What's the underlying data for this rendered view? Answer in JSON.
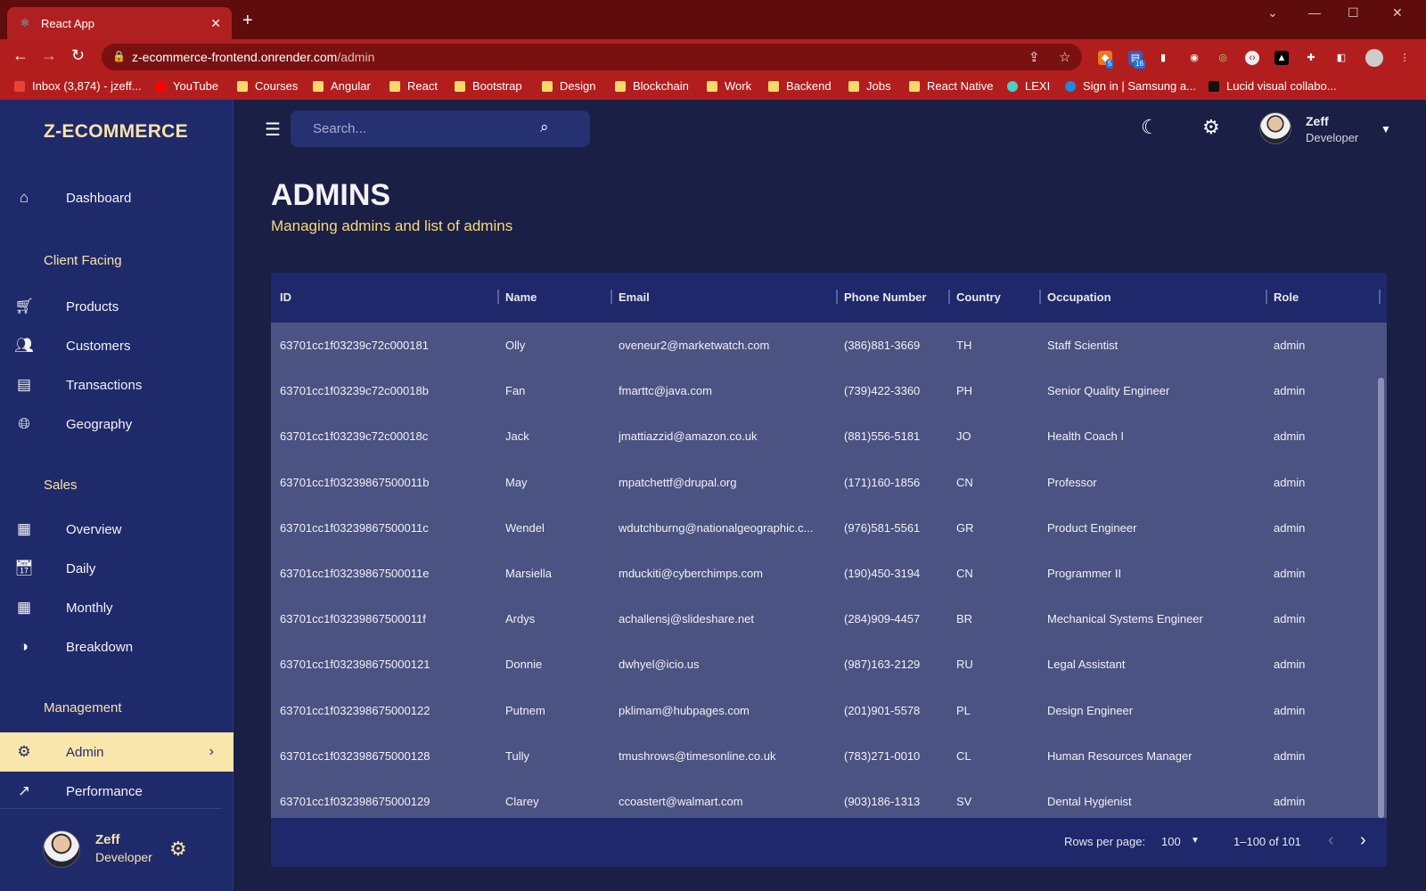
{
  "browser": {
    "tab_title": "React App",
    "tab_close": "✕",
    "new_tab": "+",
    "url_host": "z-ecommerce-frontend.onrender.com",
    "url_path": "/admin",
    "ext_badge_1": "5",
    "ext_badge_2": "16",
    "bookmarks": [
      {
        "label": "Inbox (3,874) - jzeff..."
      },
      {
        "label": "YouTube"
      },
      {
        "label": "Courses"
      },
      {
        "label": "Angular"
      },
      {
        "label": "React"
      },
      {
        "label": "Bootstrap"
      },
      {
        "label": "Design"
      },
      {
        "label": "Blockchain"
      },
      {
        "label": "Work"
      },
      {
        "label": "Backend"
      },
      {
        "label": "Jobs"
      },
      {
        "label": "React Native"
      },
      {
        "label": "LEXI"
      },
      {
        "label": "Sign in | Samsung a..."
      },
      {
        "label": "Lucid visual collabo..."
      }
    ]
  },
  "sidebar": {
    "brand": "Z-ECOMMERCE",
    "items": [
      {
        "label": "Dashboard",
        "icon": "home-icon"
      },
      {
        "label": "Client Facing"
      },
      {
        "label": "Products",
        "icon": "cart-icon"
      },
      {
        "label": "Customers",
        "icon": "people-icon"
      },
      {
        "label": "Transactions",
        "icon": "receipt-icon"
      },
      {
        "label": "Geography",
        "icon": "globe-icon"
      },
      {
        "label": "Sales"
      },
      {
        "label": "Overview",
        "icon": "point-of-sale-icon"
      },
      {
        "label": "Daily",
        "icon": "today-icon"
      },
      {
        "label": "Monthly",
        "icon": "calendar-month-icon"
      },
      {
        "label": "Breakdown",
        "icon": "pie-chart-icon"
      },
      {
        "label": "Management"
      },
      {
        "label": "Admin",
        "icon": "admin-icon",
        "active": true
      },
      {
        "label": "Performance",
        "icon": "trending-up-icon"
      }
    ],
    "user": {
      "name": "Zeff",
      "role": "Developer"
    }
  },
  "topbar": {
    "search_placeholder": "Search...",
    "user": {
      "name": "Zeff",
      "role": "Developer"
    }
  },
  "header": {
    "title": "ADMINS",
    "subtitle": "Managing admins and list of admins"
  },
  "grid": {
    "columns": [
      "ID",
      "Name",
      "Email",
      "Phone Number",
      "Country",
      "Occupation",
      "Role"
    ],
    "rows": [
      [
        "63701cc1f03239c72c000181",
        "Olly",
        "oveneur2@marketwatch.com",
        "(386)881-3669",
        "TH",
        "Staff Scientist",
        "admin"
      ],
      [
        "63701cc1f03239c72c00018b",
        "Fan",
        "fmarttc@java.com",
        "(739)422-3360",
        "PH",
        "Senior Quality Engineer",
        "admin"
      ],
      [
        "63701cc1f03239c72c00018c",
        "Jack",
        "jmattiazzid@amazon.co.uk",
        "(881)556-5181",
        "JO",
        "Health Coach I",
        "admin"
      ],
      [
        "63701cc1f03239867500011b",
        "May",
        "mpatchettf@drupal.org",
        "(171)160-1856",
        "CN",
        "Professor",
        "admin"
      ],
      [
        "63701cc1f03239867500011c",
        "Wendel",
        "wdutchburng@nationalgeographic.c...",
        "(976)581-5561",
        "GR",
        "Product Engineer",
        "admin"
      ],
      [
        "63701cc1f03239867500011e",
        "Marsiella",
        "mduckiti@cyberchimps.com",
        "(190)450-3194",
        "CN",
        "Programmer II",
        "admin"
      ],
      [
        "63701cc1f03239867500011f",
        "Ardys",
        "achallensj@slideshare.net",
        "(284)909-4457",
        "BR",
        "Mechanical Systems Engineer",
        "admin"
      ],
      [
        "63701cc1f032398675000121",
        "Donnie",
        "dwhyel@icio.us",
        "(987)163-2129",
        "RU",
        "Legal Assistant",
        "admin"
      ],
      [
        "63701cc1f032398675000122",
        "Putnem",
        "pklimam@hubpages.com",
        "(201)901-5578",
        "PL",
        "Design Engineer",
        "admin"
      ],
      [
        "63701cc1f032398675000128",
        "Tully",
        "tmushrows@timesonline.co.uk",
        "(783)271-0010",
        "CL",
        "Human Resources Manager",
        "admin"
      ],
      [
        "63701cc1f032398675000129",
        "Clarey",
        "ccoastert@walmart.com",
        "(903)186-1313",
        "SV",
        "Dental Hygienist",
        "admin"
      ]
    ],
    "footer": {
      "rows_per_page_label": "Rows per page:",
      "rows_per_page_value": "100",
      "range": "1–100 of 101"
    }
  },
  "colors": {
    "sidebar_bg": "#1f2a6b",
    "page_bg": "#191f45",
    "accent": "#f9e6ad",
    "row_bg": "#4b5382",
    "browser_frame": "#b21e1e"
  }
}
